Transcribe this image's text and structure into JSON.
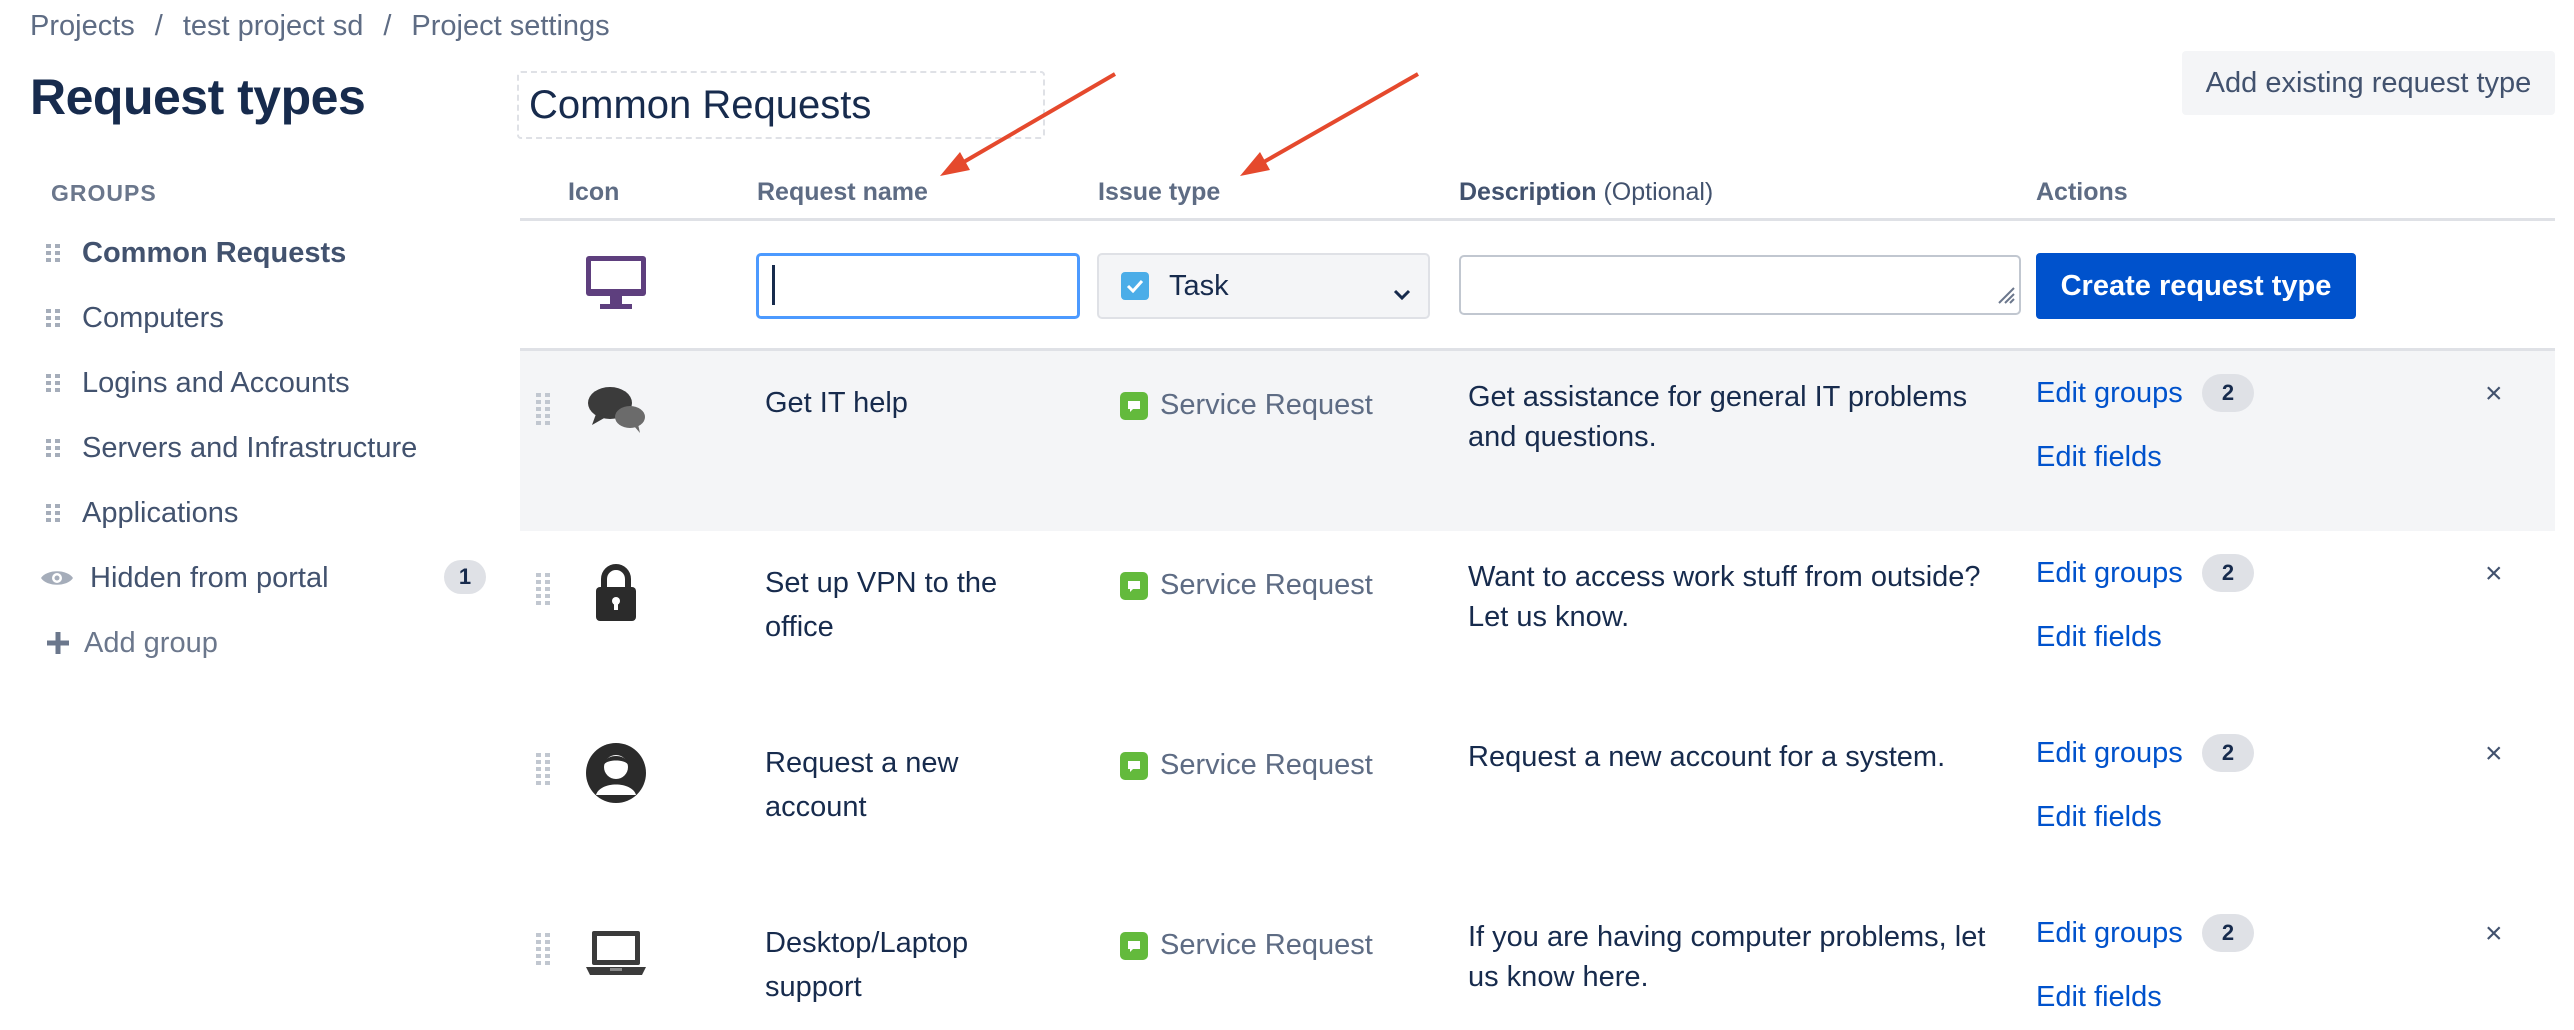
{
  "breadcrumb": [
    "Projects",
    "test project sd",
    "Project settings"
  ],
  "breadcrumb_sep": "/",
  "sidebar": {
    "title": "Request types",
    "groups_heading": "GROUPS",
    "items": [
      {
        "label": "Common Requests",
        "active": true
      },
      {
        "label": "Computers"
      },
      {
        "label": "Logins and Accounts"
      },
      {
        "label": "Servers and Infrastructure"
      },
      {
        "label": "Applications"
      }
    ],
    "hidden": {
      "label": "Hidden from portal",
      "count": "1"
    },
    "add_group": "Add group"
  },
  "main": {
    "group_name": "Common Requests",
    "add_existing": "Add existing request type",
    "headers": {
      "icon": "Icon",
      "request_name": "Request name",
      "issue_type": "Issue type",
      "description": "Description",
      "description_optional": "(Optional)",
      "actions": "Actions"
    },
    "new_row": {
      "name_value": "",
      "issue_type": "Task",
      "description_value": "",
      "create_label": "Create request type",
      "icon": "monitor-icon"
    },
    "rows": [
      {
        "icon": "chat-bubbles-icon",
        "name": "Get IT help",
        "issue_type": "Service Request",
        "description": "Get assistance for general IT problems and questions.",
        "edit_groups": "Edit groups",
        "groups_count": "2",
        "edit_fields": "Edit fields",
        "close": "×"
      },
      {
        "icon": "lock-icon",
        "name": "Set up VPN to the office",
        "issue_type": "Service Request",
        "description": "Want to access work stuff from outside? Let us know.",
        "edit_groups": "Edit groups",
        "groups_count": "2",
        "edit_fields": "Edit fields",
        "close": "×"
      },
      {
        "icon": "user-circle-icon",
        "name": "Request a new account",
        "issue_type": "Service Request",
        "description": "Request a new account for a system.",
        "edit_groups": "Edit groups",
        "groups_count": "2",
        "edit_fields": "Edit fields",
        "close": "×"
      },
      {
        "icon": "laptop-icon",
        "name": "Desktop/Laptop support",
        "issue_type": "Service Request",
        "description": "If you are having computer problems, let us know here.",
        "edit_groups": "Edit groups",
        "groups_count": "2",
        "edit_fields": "Edit fields",
        "close": "×"
      }
    ]
  },
  "colors": {
    "link": "#0052cc",
    "primary_button": "#0052cc",
    "annotation_arrow": "#e5492d",
    "service_request": "#63ba3c",
    "task": "#4bade8"
  }
}
